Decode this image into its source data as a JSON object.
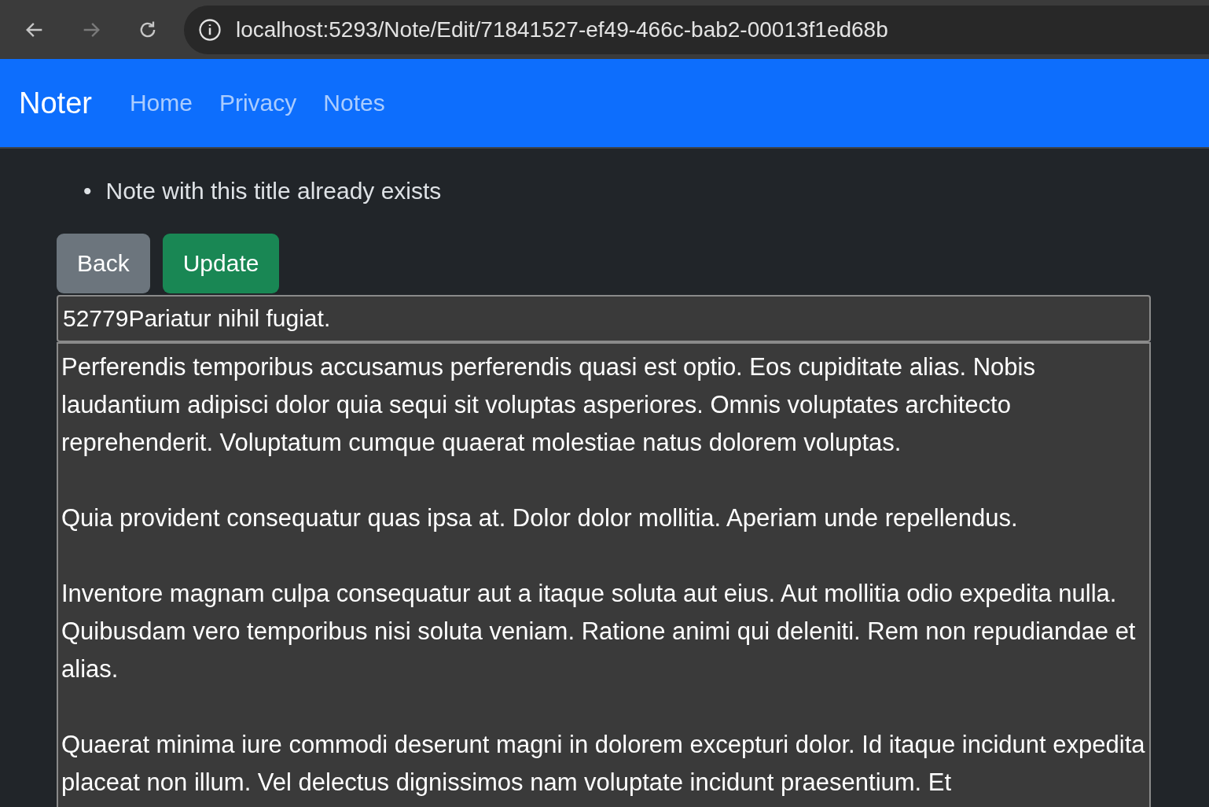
{
  "browser": {
    "back_enabled": true,
    "forward_enabled": false,
    "url": "localhost:5293/Note/Edit/71841527-ef49-466c-bab2-00013f1ed68b"
  },
  "navbar": {
    "brand": "Noter",
    "links": [
      "Home",
      "Privacy",
      "Notes"
    ]
  },
  "errors": [
    {
      "marker": "•",
      "text": "Note with this title already exists"
    }
  ],
  "buttons": [
    {
      "label": "Back",
      "kind": "secondary"
    },
    {
      "label": "Update",
      "kind": "success"
    }
  ],
  "title_field": {
    "value": "52779Pariatur nihil fugiat."
  },
  "body_field": {
    "value": "Perferendis temporibus accusamus perferendis quasi est optio. Eos cupiditate alias. Nobis laudantium adipisci dolor quia sequi sit voluptas asperiores. Omnis voluptates architecto reprehenderit. Voluptatum cumque quaerat molestiae natus dolorem voluptas.\n\nQuia provident consequatur quas ipsa at. Dolor dolor mollitia. Aperiam unde repellendus.\n\nInventore magnam culpa consequatur aut a itaque soluta aut eius. Aut mollitia odio expedita nulla. Quibusdam vero temporibus nisi soluta veniam. Ratione animi qui deleniti. Rem non repudiandae et alias.\n\nQuaerat minima iure commodi deserunt magni in dolorem excepturi dolor. Id itaque incidunt expedita placeat non illum. Vel delectus dignissimos nam voluptate incidunt praesentium. Et"
  }
}
